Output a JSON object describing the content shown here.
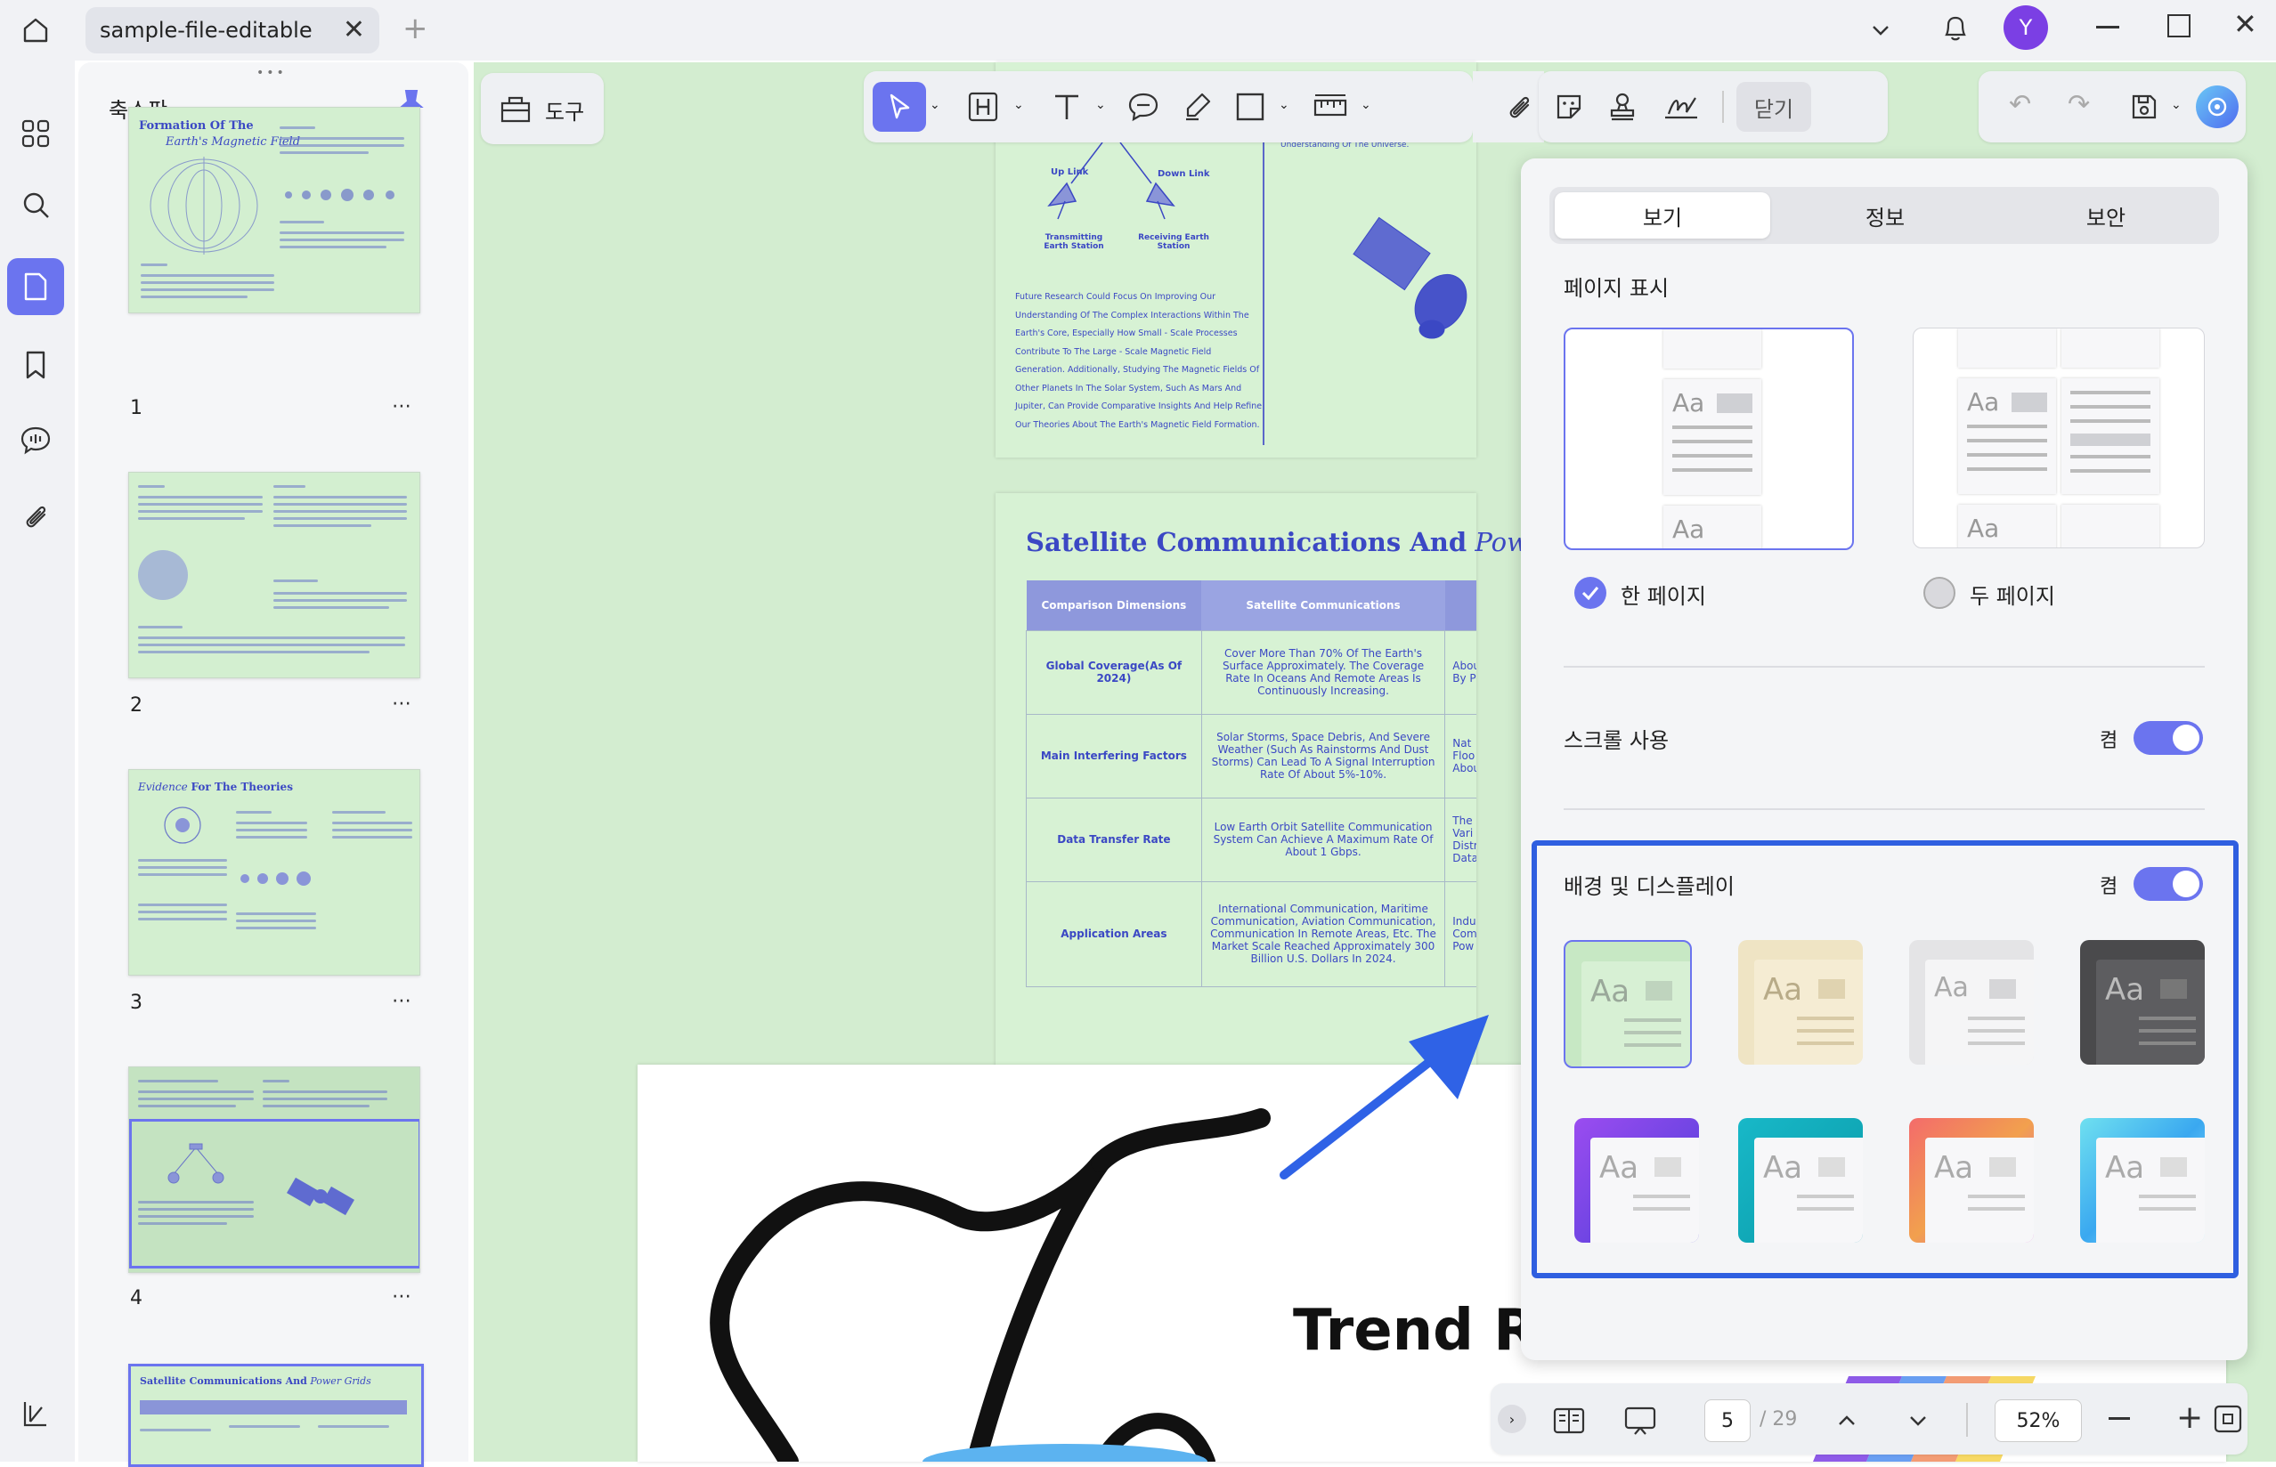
{
  "titlebar": {
    "tab_title": "sample-file-editable",
    "avatar_letter": "Y"
  },
  "thumbnail_panel": {
    "title": "축소판",
    "pages": [
      {
        "number": "1",
        "heading_a": "Formation Of The",
        "heading_b": "Earth's Magnetic Field"
      },
      {
        "number": "2"
      },
      {
        "number": "3",
        "heading_a": "Evidence",
        "heading_b": "For The Theories"
      },
      {
        "number": "4"
      },
      {
        "number": "",
        "heading_a": "Satellite Communications And",
        "heading_b": "Power Grids"
      }
    ],
    "more_label": "⋯"
  },
  "toolbar": {
    "tools_label": "도구",
    "close_label": "닫기"
  },
  "document": {
    "page4": {
      "uplink": "Up Link",
      "downlink": "Down Link",
      "transmitting": "Transmitting Earth Station",
      "receiving": "Receiving Earth Station",
      "right_text": "Understanding Of The Universe.",
      "body": "Future Research Could Focus On Improving Our Understanding Of The Complex Interactions Within The Earth's Core, Especially How Small - Scale Processes Contribute To The Large - Scale Magnetic Field Generation. Additionally, Studying The Magnetic Fields Of Other Planets In The Solar System, Such As Mars And Jupiter, Can Provide Comparative Insights And Help Refine Our Theories About The Earth's Magnetic Field Formation."
    },
    "page5": {
      "title_a": "Satellite Communications And",
      "title_b": "Power Grids",
      "headers": [
        "Comparison Dimensions",
        "Satellite Communications"
      ],
      "rows": [
        {
          "dim": "Global Coverage(As Of 2024)",
          "sat": "Cover More Than 70% Of The Earth's Surface Approximately. The Coverage Rate In Oceans And Remote Areas Is Continuously Increasing.",
          "extra": "About I\nBy Po"
        },
        {
          "dim": "Main Interfering Factors",
          "sat": "Solar Storms, Space Debris, And Severe Weather (Such As Rainstorms And Dust Storms) Can Lead To A Signal Interruption Rate Of About 5%-10%.",
          "extra": "Nat\nFloo\nAbou"
        },
        {
          "dim": "Data Transfer Rate",
          "sat": "Low Earth Orbit Satellite Communication System Can Achieve A Maximum Rate Of About 1 Gbps.",
          "extra": "The I\nVari\nDistrib\nData"
        },
        {
          "dim": "Application Areas",
          "sat": "International Communication, Maritime Communication, Aviation Communication, Communication In Remote Areas, Etc. The Market Scale Reached Approximately 300 Billion U.S. Dollars In 2024.",
          "extra": "Indu\nComm\nPow"
        }
      ]
    },
    "page6": {
      "title": "Trend Research"
    }
  },
  "settings_panel": {
    "tabs": [
      "보기",
      "정보",
      "보안"
    ],
    "page_display_title": "페이지 표시",
    "single_page_label": "한 페이지",
    "two_page_label": "두 페이지",
    "scroll_label": "스크롤 사용",
    "scroll_state": "켬",
    "background_label": "배경 및 디스플레이",
    "background_state": "켬",
    "theme_sample": "Aa",
    "colors": {
      "accent": "#6b74ef",
      "highlight_border": "#2f5fe0"
    }
  },
  "bottombar": {
    "current_page": "5",
    "total_pages": "/ 29",
    "zoom": "52%"
  }
}
